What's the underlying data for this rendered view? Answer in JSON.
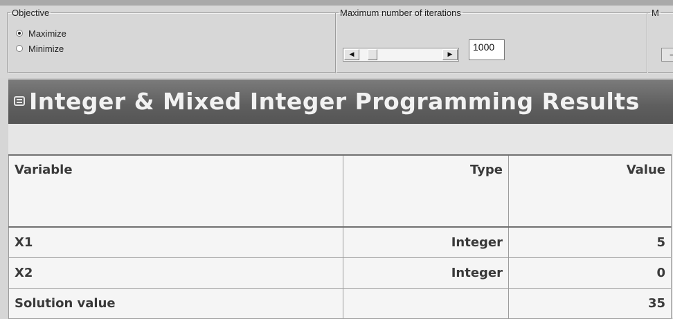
{
  "objective": {
    "legend": "Objective",
    "options": [
      {
        "label": "Maximize",
        "selected": true
      },
      {
        "label": "Minimize",
        "selected": false
      }
    ]
  },
  "iterations": {
    "legend": "Maximum number of iterations",
    "value": "1000"
  },
  "third_group": {
    "legend": "M"
  },
  "results": {
    "title": "Integer & Mixed Integer Programming Results",
    "columns": [
      "Variable",
      "Type",
      "Value"
    ],
    "rows": [
      {
        "variable": "X1",
        "type": "Integer",
        "value": "5"
      },
      {
        "variable": "X2",
        "type": "Integer",
        "value": "0"
      },
      {
        "variable": "Solution value",
        "type": "",
        "value": "35"
      }
    ]
  },
  "colors": {
    "header_bg": "#5e5e5e",
    "panel_bg": "#d7d7d7",
    "table_bg": "#f5f5f5"
  }
}
